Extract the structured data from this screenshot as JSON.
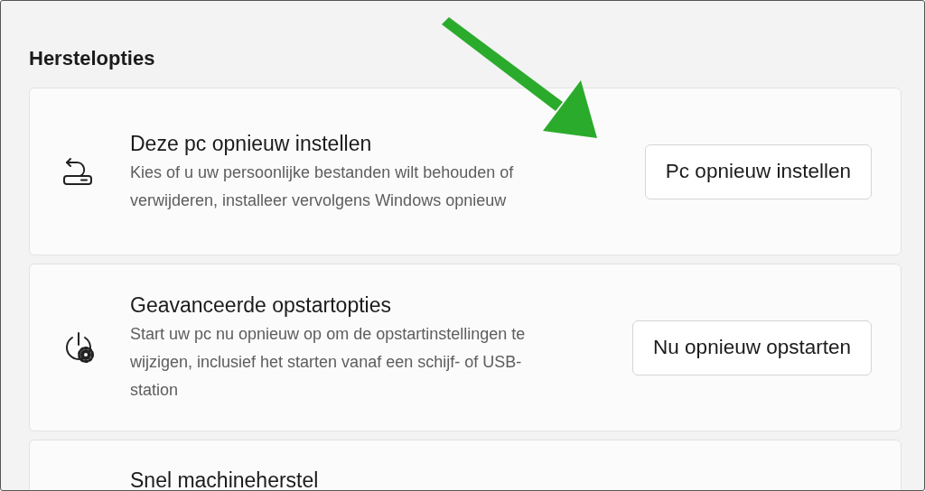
{
  "section_title": "Herstelopties",
  "cards": [
    {
      "kind": "reset",
      "title": "Deze pc opnieuw instellen",
      "description": "Kies of u uw persoonlijke bestanden wilt behouden of verwijderen, installeer vervolgens Windows opnieuw",
      "button": "Pc opnieuw instellen"
    },
    {
      "kind": "startup",
      "title": "Geavanceerde opstartopties",
      "description": "Start uw pc nu opnieuw op om de opstartinstellingen te wijzigen, inclusief het starten vanaf een schijf- of USB-station",
      "button": "Nu opnieuw opstarten"
    },
    {
      "kind": "repair",
      "title": "Snel machineherstel"
    }
  ]
}
